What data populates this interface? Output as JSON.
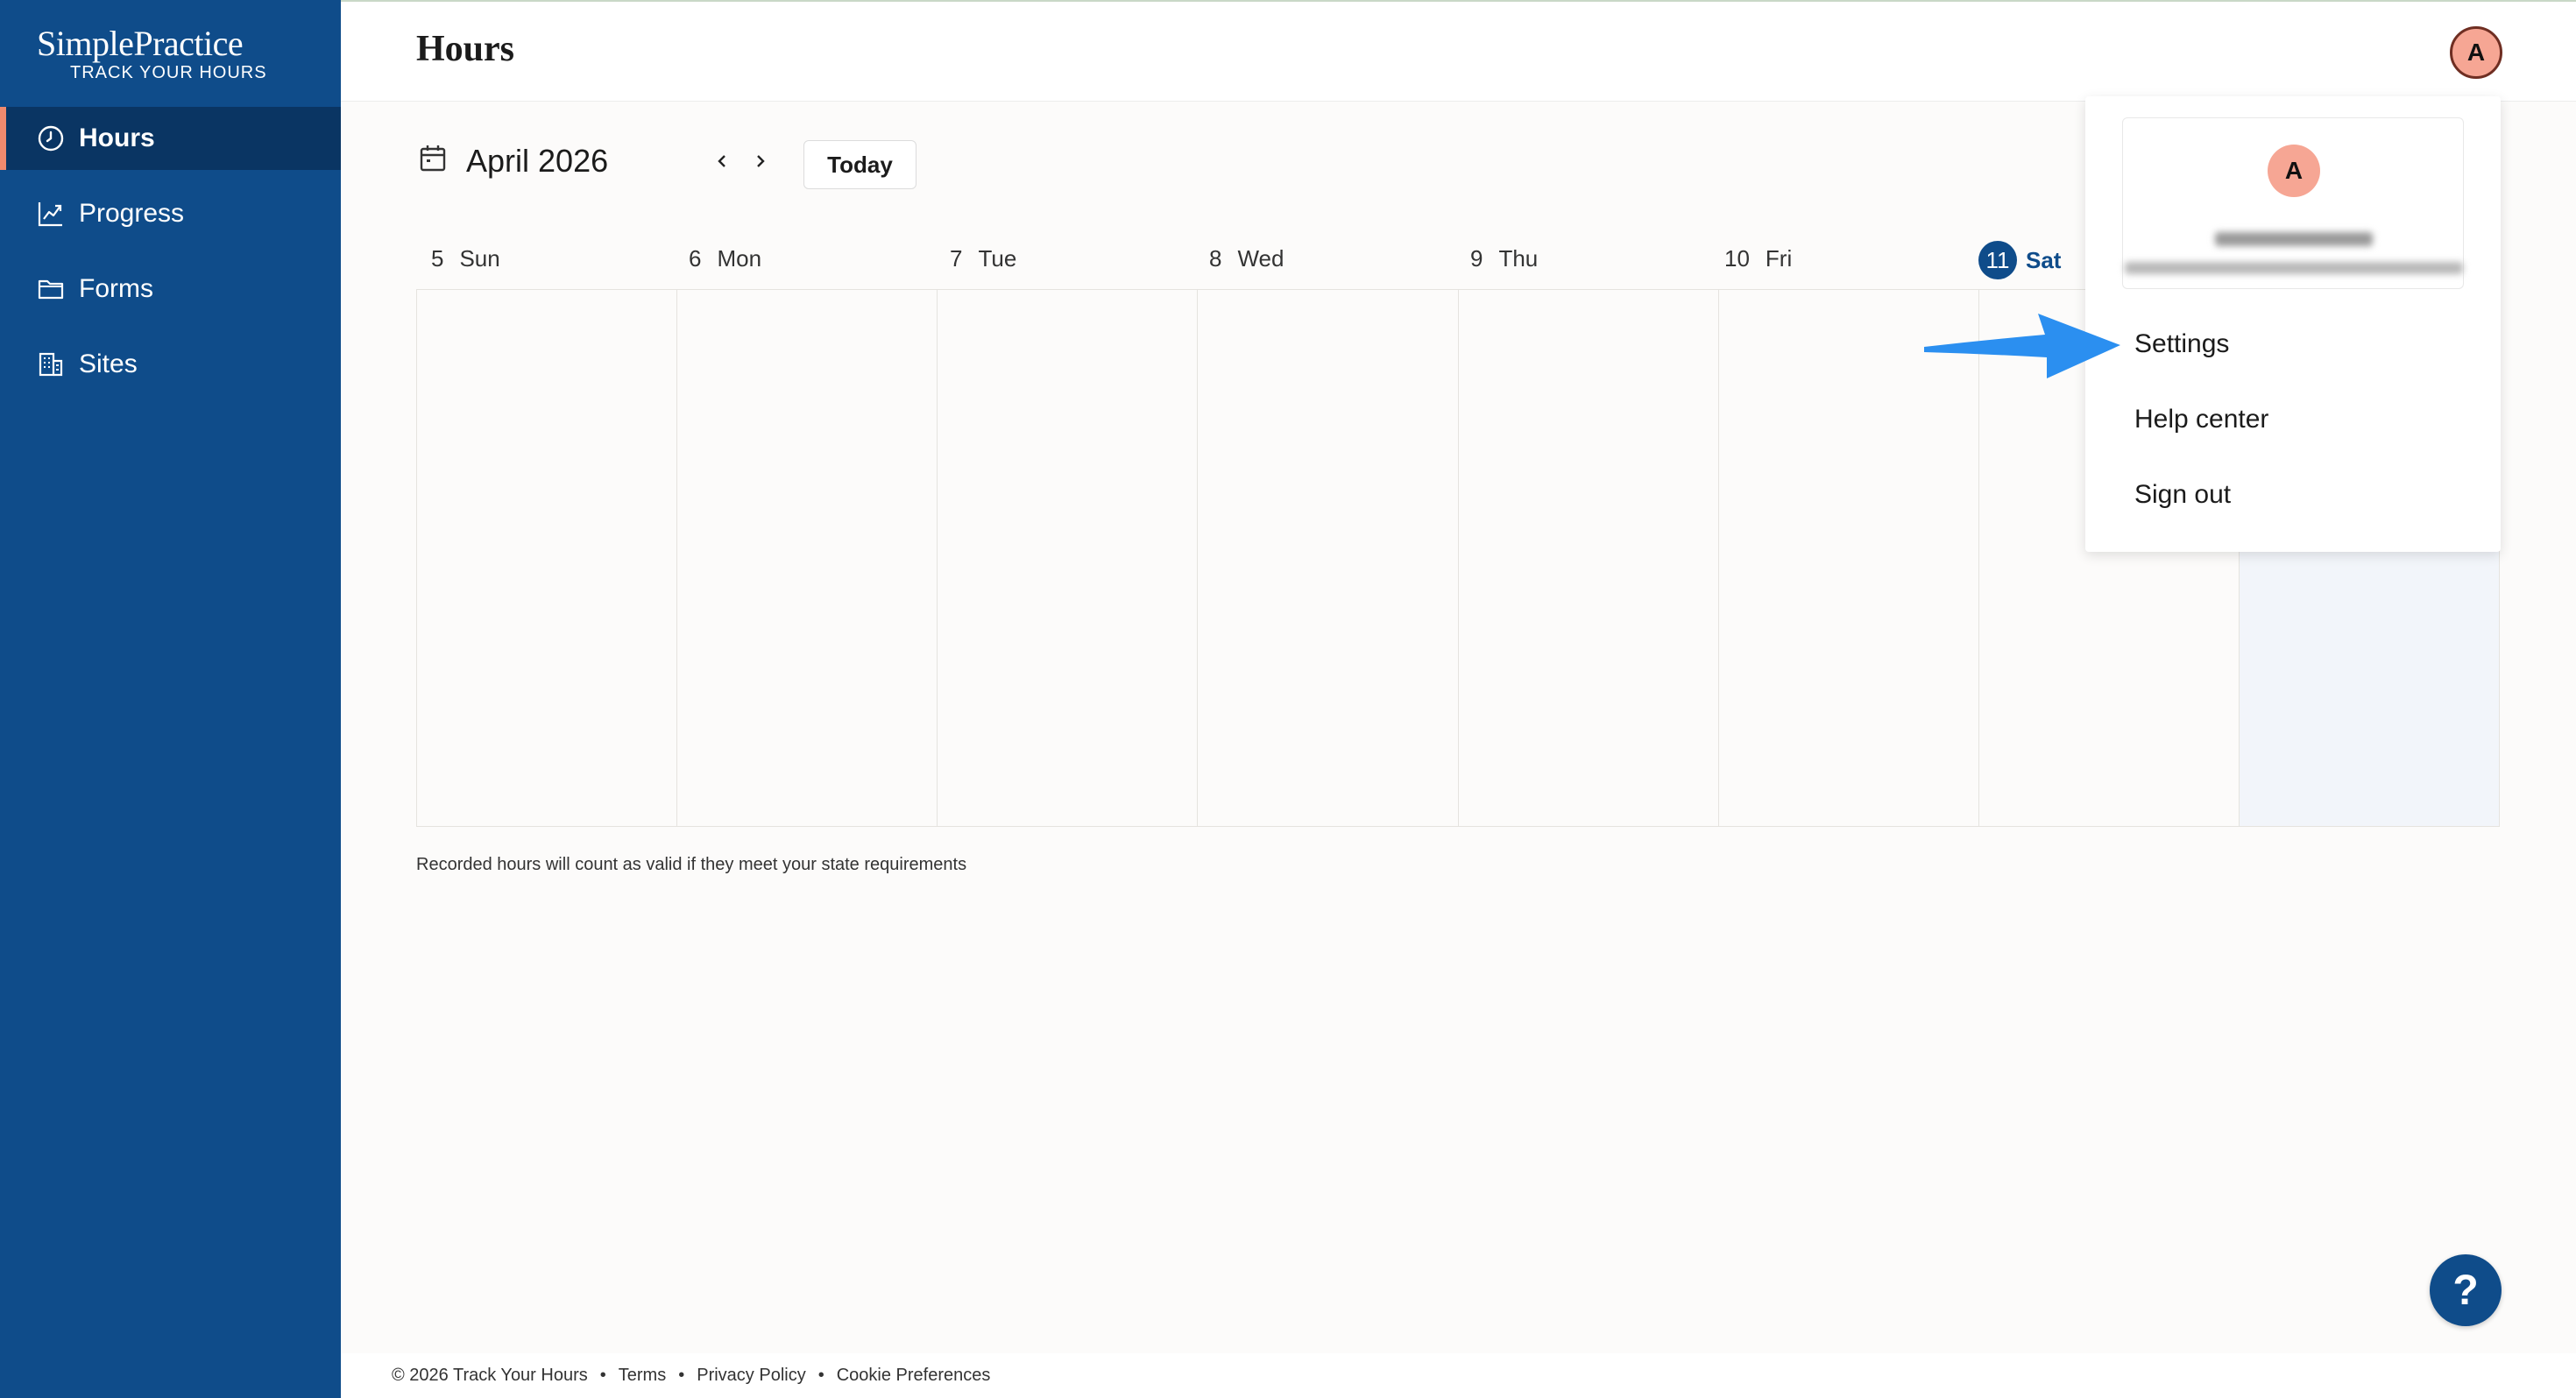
{
  "app": {
    "logo_main": "SimplePractice",
    "logo_sub": "TRACK YOUR HOURS"
  },
  "sidebar": {
    "items": [
      {
        "label": "Hours",
        "icon": "clock-icon",
        "active": true
      },
      {
        "label": "Progress",
        "icon": "chart-line-icon",
        "active": false
      },
      {
        "label": "Forms",
        "icon": "folder-icon",
        "active": false
      },
      {
        "label": "Sites",
        "icon": "building-icon",
        "active": false
      }
    ]
  },
  "header": {
    "title": "Hours",
    "avatar_initial": "A"
  },
  "calendar": {
    "month": "April 2026",
    "today_label": "Today",
    "days": [
      {
        "num": "5",
        "name": "Sun"
      },
      {
        "num": "6",
        "name": "Mon"
      },
      {
        "num": "7",
        "name": "Tue"
      },
      {
        "num": "8",
        "name": "Wed"
      },
      {
        "num": "9",
        "name": "Thu"
      },
      {
        "num": "10",
        "name": "Fri"
      },
      {
        "num": "11",
        "name": "Sat",
        "is_today": true
      }
    ],
    "footnote": "Recorded hours will count as valid if they meet your state requirements"
  },
  "user_menu": {
    "avatar_initial": "A",
    "items": [
      "Settings",
      "Help center",
      "Sign out"
    ]
  },
  "footer": {
    "copyright": "© 2026 Track Your Hours",
    "links": [
      "Terms",
      "Privacy Policy",
      "Cookie Preferences"
    ],
    "separator": "•"
  },
  "help_button": "?",
  "colors": {
    "sidebar": "#0f4c8a",
    "sidebar_active": "#0a3563",
    "accent": "#f08a6e",
    "avatar": "#f6a694",
    "annotation_arrow": "#2b8ff0"
  }
}
